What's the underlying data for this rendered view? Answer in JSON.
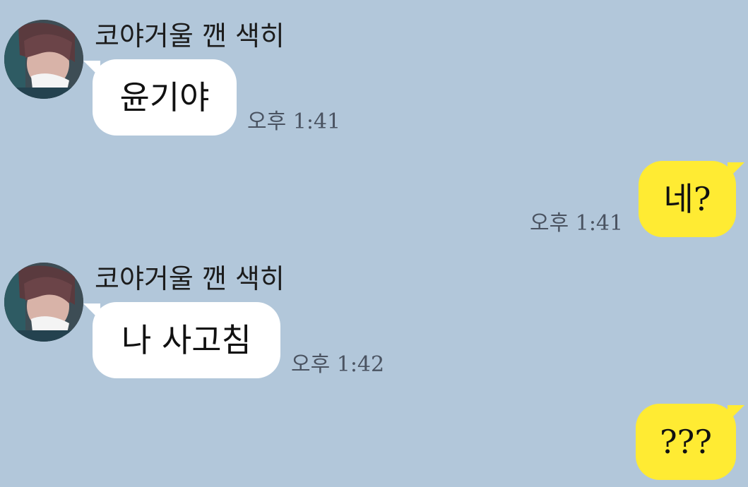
{
  "chat": {
    "background_color": "#b2c7da",
    "incoming_bubble_color": "#ffffff",
    "outgoing_bubble_color": "#ffeb33",
    "messages": [
      {
        "direction": "incoming",
        "sender": "코야거울 깬 색히",
        "avatar_icon": "profile-photo",
        "text": "윤기야",
        "time": "오후 1:41"
      },
      {
        "direction": "outgoing",
        "text": "네?",
        "time": "오후 1:41"
      },
      {
        "direction": "incoming",
        "sender": "코야거울 깬 색히",
        "avatar_icon": "profile-photo",
        "text": "나 사고침",
        "time": "오후 1:42"
      },
      {
        "direction": "outgoing",
        "text": "???",
        "time": ""
      }
    ]
  }
}
